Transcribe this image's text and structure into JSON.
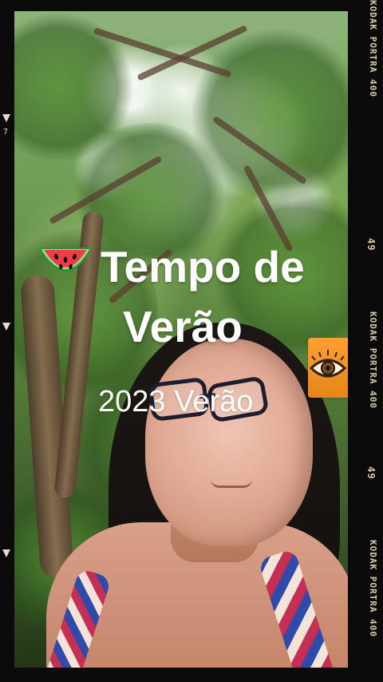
{
  "screen": {
    "title_line1": "Tempo de",
    "title_line2": "Verão",
    "subtitle": "2023 Verão",
    "emoji": "watermelon-icon",
    "sticker": "eye-sticker-icon"
  },
  "film_border": {
    "top_label": "KODAK PORTRA 400",
    "frame_number": "49",
    "middle_label": "KODAK PORTRA 400",
    "second_frame_number": "49",
    "bottom_label": "KODAK PORTRA 400",
    "left_marker_number": "7"
  },
  "colors": {
    "title_text": "#ffffff",
    "subtitle_text": "#fffefb",
    "film_text": "#d9c9a6",
    "sticker_orange": "#ff9f32"
  }
}
